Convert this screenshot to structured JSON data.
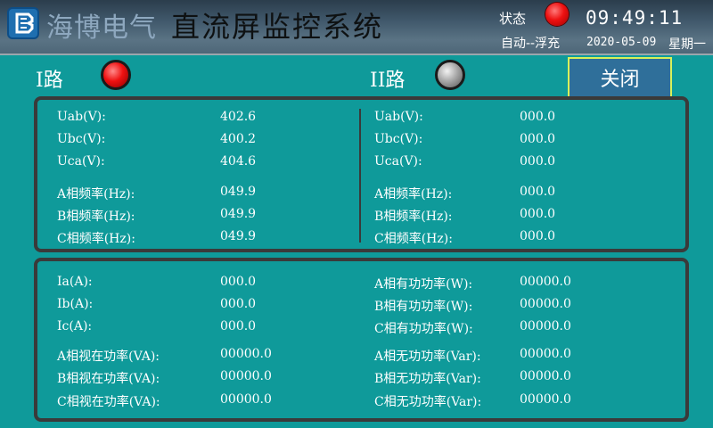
{
  "header": {
    "logo_text": "海博电气",
    "title": "直流屏监控系统",
    "status_label": "状态",
    "status_color": "#ee1111",
    "time": "09:49:11",
    "mode": "自动--浮充",
    "date": "2020-05-09",
    "weekday": "星期一"
  },
  "routes": {
    "route1": {
      "label": "I路",
      "lamp": "red"
    },
    "route2": {
      "label": "II路",
      "lamp": "grey"
    }
  },
  "close_label": "关闭",
  "voltage_panel": {
    "left": [
      {
        "label": "Uab(V):",
        "value": "402.6"
      },
      {
        "label": "Ubc(V):",
        "value": "400.2"
      },
      {
        "label": "Uca(V):",
        "value": "404.6"
      },
      {
        "label": "A相频率(Hz):",
        "value": "049.9"
      },
      {
        "label": "B相频率(Hz):",
        "value": "049.9"
      },
      {
        "label": "C相频率(Hz):",
        "value": "049.9"
      }
    ],
    "right": [
      {
        "label": "Uab(V):",
        "value": "000.0"
      },
      {
        "label": "Ubc(V):",
        "value": "000.0"
      },
      {
        "label": "Uca(V):",
        "value": "000.0"
      },
      {
        "label": "A相频率(Hz):",
        "value": "000.0"
      },
      {
        "label": "B相频率(Hz):",
        "value": "000.0"
      },
      {
        "label": "C相频率(Hz):",
        "value": "000.0"
      }
    ]
  },
  "power_panel": {
    "left": [
      {
        "label": "Ia(A):",
        "value": "000.0"
      },
      {
        "label": "Ib(A):",
        "value": "000.0"
      },
      {
        "label": "Ic(A):",
        "value": "000.0"
      },
      {
        "label": "A相视在功率(VA):",
        "value": "00000.0"
      },
      {
        "label": "B相视在功率(VA):",
        "value": "00000.0"
      },
      {
        "label": "C相视在功率(VA):",
        "value": "00000.0"
      }
    ],
    "right": [
      {
        "label": "A相有功功率(W):",
        "value": "00000.0"
      },
      {
        "label": "B相有功功率(W):",
        "value": "00000.0"
      },
      {
        "label": "C相有功功率(W):",
        "value": "00000.0"
      },
      {
        "label": "A相无功功率(Var):",
        "value": "00000.0"
      },
      {
        "label": "B相无功功率(Var):",
        "value": "00000.0"
      },
      {
        "label": "C相无功功率(Var):",
        "value": "00000.0"
      }
    ]
  }
}
